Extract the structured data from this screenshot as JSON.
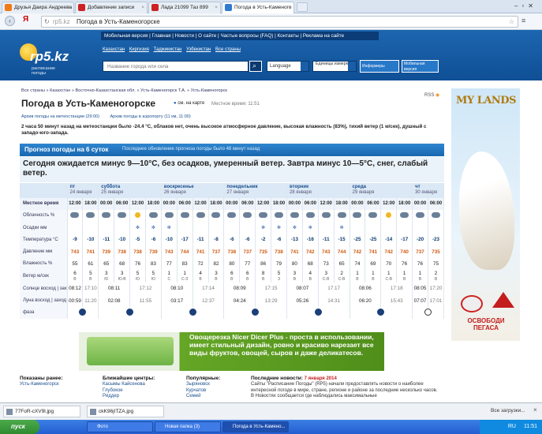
{
  "browser": {
    "tabs": [
      {
        "label": "Друзья Даира Андреева"
      },
      {
        "label": "Добавление записи"
      },
      {
        "label": "Лада 21099 Таз 899"
      },
      {
        "label": "Погода в Усть-Каменого"
      }
    ],
    "url_domain": "rp5.kz",
    "url_title": "Погода в Усть-Каменогорске"
  },
  "site": {
    "logo": "rp5.kz",
    "logo_sub": "расписание погоды",
    "menu": [
      "Мобильная версия",
      "Главная",
      "Новости",
      "О сайте",
      "Частые вопросы (FAQ)",
      "Контакты",
      "Реклама на сайте"
    ],
    "countries": [
      "Казахстан",
      "Киргизия",
      "Таджикистан",
      "Узбекистан",
      "Все страны"
    ],
    "search_placeholder": "Название города или села",
    "language": "Language",
    "units": "Единицы измерений",
    "informers": "Информеры",
    "mobile": "Мобильная версия",
    "rss": "RSS"
  },
  "page": {
    "breadcrumb": "Все страны » Казахстан » Восточно-Казахстанская обл. » Усть-Каменогорск Т.А. » Усть-Каменогорск",
    "title": "Погода в Усть-Каменогорске",
    "map_link": "см. на карте",
    "local_time": "Местное время: 11:51",
    "archive_station": "Архив погоды на метеостанции (29:00)",
    "archive_airport": "Архив погоды в аэропорту (11 км, 11:00)",
    "observation": "2 часа 50 минут назад на метеостанции было -24.4 °C, облаков нет, очень высокое атмосферное давление, высокая влажность (83%), тихий ветер (1 м/сек), душный с западо-юго-запада.",
    "forecast_heading": "Прогноз погоды на 6 суток",
    "forecast_update": "Последнее обновление прогноза погоды было 48 минут назад",
    "summary": "Сегодня ожидается минус 9—10°C, без осадков, умеренный ветер. Завтра минус 10—5°C, снег, слабый ветер."
  },
  "forecast": {
    "row_labels": [
      "Местное время",
      "Облачность %",
      "Осадки мм",
      "Температура °C",
      "Давление мм",
      "Влажность %",
      "Ветер м/сек",
      "Солнце восход | заход",
      "Луна восход | заход",
      "фаза"
    ],
    "days": [
      {
        "name": "пт",
        "date": "24 января",
        "cols": 2
      },
      {
        "name": "суббота",
        "date": "25 января",
        "cols": 4
      },
      {
        "name": "воскресенье",
        "date": "26 января",
        "cols": 4
      },
      {
        "name": "понедельник",
        "date": "27 января",
        "cols": 4
      },
      {
        "name": "вторник",
        "date": "28 января",
        "cols": 4
      },
      {
        "name": "среда",
        "date": "29 января",
        "cols": 4
      },
      {
        "name": "чт",
        "date": "30 января",
        "cols": 2
      }
    ],
    "hours": [
      "12:00",
      "18:00",
      "00:00",
      "06:00",
      "12:00",
      "18:00",
      "00:00",
      "06:00",
      "12:00",
      "18:00",
      "00:00",
      "06:00",
      "12:00",
      "18:00",
      "00:00",
      "06:00",
      "12:00",
      "18:00",
      "00:00",
      "06:00",
      "12:00",
      "18:00",
      "00:00",
      "06:00"
    ],
    "temps": [
      "-9",
      "-10",
      "-11",
      "-10",
      "-5",
      "-6",
      "-10",
      "-17",
      "-11",
      "-8",
      "-6",
      "-6",
      "-2",
      "-6",
      "-13",
      "-16",
      "-11",
      "-15",
      "-25",
      "-25",
      "-14",
      "-17",
      "-20",
      "-23"
    ],
    "pressure": [
      "743",
      "741",
      "739",
      "738",
      "738",
      "739",
      "743",
      "744",
      "741",
      "737",
      "738",
      "737",
      "735",
      "738",
      "741",
      "742",
      "743",
      "744",
      "742",
      "741",
      "742",
      "740",
      "737",
      "735"
    ],
    "humidity": [
      "55",
      "61",
      "65",
      "68",
      "76",
      "83",
      "77",
      "83",
      "72",
      "82",
      "80",
      "77",
      "86",
      "79",
      "80",
      "68",
      "73",
      "65",
      "74",
      "69",
      "70",
      "76",
      "76",
      "75"
    ],
    "wind": [
      "6",
      "5",
      "3",
      "3",
      "5",
      "5",
      "1",
      "1",
      "4",
      "3",
      "6",
      "6",
      "8",
      "5",
      "3",
      "4",
      "3",
      "2",
      "1",
      "1",
      "1",
      "1",
      "1",
      "2"
    ],
    "wind_dir": [
      "В",
      "В",
      "Ю",
      "Ю-В",
      "Ю",
      "Ю",
      "С",
      "С-З",
      "В",
      "В",
      "В",
      "В",
      "В",
      "З",
      "В",
      "В",
      "С-В",
      "С-В",
      "В",
      "В",
      "С-В",
      "В",
      "В",
      "В"
    ],
    "sun": [
      [
        "08:12",
        "17:10"
      ],
      [
        "08:11",
        "17:12"
      ],
      [
        "08:10",
        "17:14"
      ],
      [
        "08:09",
        "17:15"
      ],
      [
        "08:07",
        "17:17"
      ],
      [
        "08:06",
        "17:18"
      ],
      [
        "08:05",
        "17:20"
      ]
    ],
    "moon": [
      [
        "00:59",
        "11:20"
      ],
      [
        "02:08",
        "11:55"
      ],
      [
        "03:17",
        "12:37"
      ],
      [
        "04:24",
        "13:29"
      ],
      [
        "05:26",
        "14:31"
      ],
      [
        "06:20",
        "15:43"
      ],
      [
        "07:07",
        "17:01"
      ]
    ]
  },
  "ad": {
    "title": "Овощерезка Nicer Dicer Plus - проста в использовании, имеет стильный дизайн, ровно и красиво нарезает все виды фруктов, овощей, сыров и даже деликатесов."
  },
  "banner": {
    "brand": "MY LANDS",
    "cta": "ОСВОБОДИ ПЕГАСА"
  },
  "bottom": {
    "viewed_title": "Показаны ранее:",
    "viewed": [
      "Усть-Каменогорск"
    ],
    "near_title": "Ближайшие центры:",
    "near": [
      "Касымы Кайсенова",
      "Глубокое",
      "Риддер"
    ],
    "popular_title": "Популярные:",
    "popular": [
      "Зыряновск",
      "Курчатов",
      "Семей"
    ],
    "news_title": "Последние новости:",
    "news_date": "7 января 2014",
    "news_text": "Сайты \"Расписание Погоды\" (RP5) начали предоставлять новости о наиболее интересной погоде в мире, стране, регионе и районе за последние несколько часов. В Новостях сообщается где наблюдались максимальные"
  },
  "downloads": [
    {
      "name": "77FoR-cXV9l.jpg"
    },
    {
      "name": "ckK96jITZA.jpg"
    }
  ],
  "downloads_all": "Все загрузки...",
  "taskbar": {
    "start": "пуск",
    "items": [
      "Фото",
      "Новая папка (3)",
      "Погода в Усть-Камено..."
    ],
    "lang": "RU",
    "clock": "11:51"
  }
}
